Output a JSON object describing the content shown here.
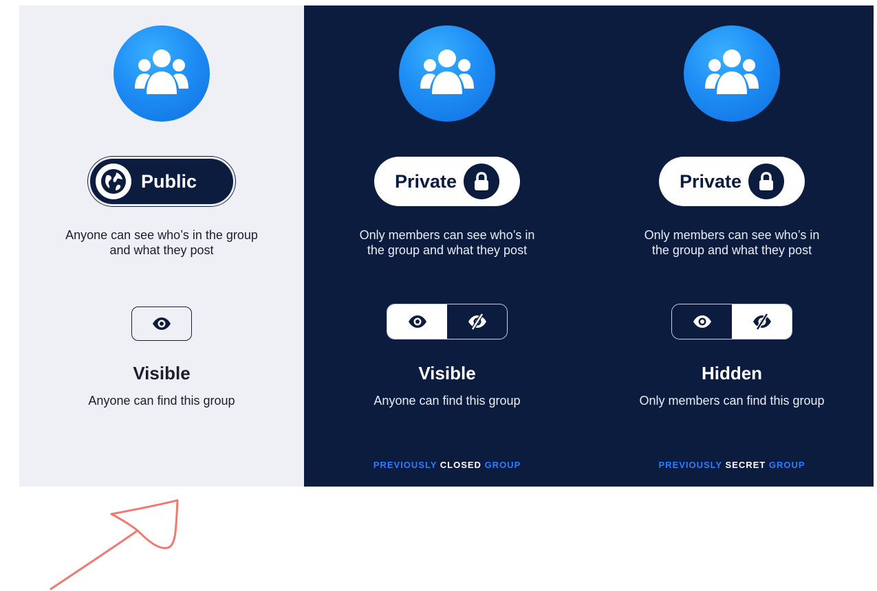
{
  "panels": {
    "public": {
      "pill_label": "Public",
      "pill_icon": "globe-icon",
      "desc_line1": "Anyone can see who’s in the group",
      "desc_line2": "and what they post",
      "visibility_title": "Visible",
      "visibility_desc": "Anyone can find this group"
    },
    "closed": {
      "pill_label": "Private",
      "pill_icon": "lock-icon",
      "desc_line1": "Only members can see who’s in",
      "desc_line2": "the group and what they post",
      "toggle_selected": "visible",
      "visibility_title": "Visible",
      "visibility_desc": "Anyone can find this group",
      "footer_prefix": "PREVIOUSLY",
      "footer_keyword": "CLOSED",
      "footer_suffix": "GROUP"
    },
    "secret": {
      "pill_label": "Private",
      "pill_icon": "lock-icon",
      "desc_line1": "Only members can see who’s in",
      "desc_line2": "the group and what they post",
      "toggle_selected": "hidden",
      "visibility_title": "Hidden",
      "visibility_desc": "Only members can find this group",
      "footer_prefix": "PREVIOUSLY",
      "footer_keyword": "SECRET",
      "footer_suffix": "GROUP"
    }
  },
  "colors": {
    "navy": "#0c1c3f",
    "light_bg": "#eef0f6",
    "accent_blue": "#1e8ef5",
    "footer_blue": "#2f7bff",
    "annotation_red": "#f07a72"
  },
  "icons": {
    "group": "group-members-icon",
    "eye": "eye-icon",
    "eye_off": "eye-slash-icon",
    "annotation": "hand-drawn-arrow"
  }
}
